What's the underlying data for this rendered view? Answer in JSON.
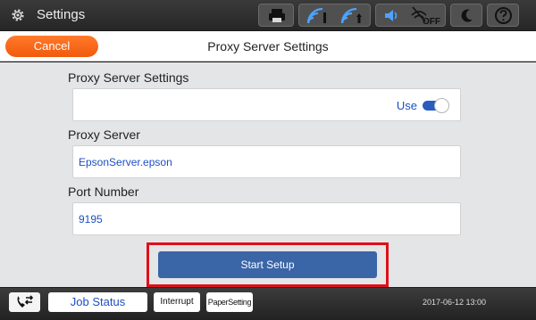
{
  "topbar": {
    "title": "Settings",
    "status_icons": [
      "printer-icon",
      "wifi-icon",
      "wifi-direct-icon",
      "volume-icon",
      "wifi-off-icon",
      "sleep-moon-icon",
      "help-icon"
    ],
    "wifi_off_label": "OFF"
  },
  "header": {
    "cancel_label": "Cancel",
    "title": "Proxy Server Settings"
  },
  "main": {
    "proxy_settings": {
      "label": "Proxy Server Settings",
      "toggle_label": "Use",
      "toggle_on": true
    },
    "proxy_server": {
      "label": "Proxy Server",
      "value": "EpsonServer.epson"
    },
    "port_number": {
      "label": "Port Number",
      "value": "9195"
    },
    "start_setup_label": "Start Setup",
    "highlight_color": "#e0101a",
    "accent_color": "#3a65a6"
  },
  "bottombar": {
    "job_status_label": "Job Status",
    "interrupt_label": "Interrupt",
    "paper_setting_label": "PaperSetting",
    "datetime": "2017-06-12 13:00"
  }
}
